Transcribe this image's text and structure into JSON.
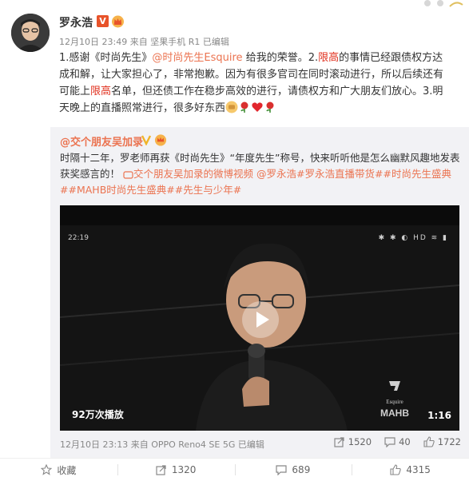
{
  "post": {
    "username": "罗永浩",
    "verified_mark": "V",
    "meta": {
      "time": "12月10日 23:49",
      "source_prefix": "来自",
      "source": "坚果手机 R1",
      "edited": "已编辑"
    },
    "text": {
      "p1": "1.感谢《时尚先生》",
      "link": "@时尚先生Esquire",
      "p2": " 给我的荣誉。2.",
      "red1": "限高",
      "p3": "的事情已经跟债权方达成和解，让大家担心了，非常抱歉。因为有很多官司在同时滚动进行，所以后续还有可能上",
      "red2": "限高",
      "p4": "名单，但还债工作在稳步高效的进行，请债权方和广大朋友们放心。3.明天晚上的直播照常进行，很多好东西"
    }
  },
  "repost": {
    "author": "@交个朋友吴加录",
    "text": {
      "t1": "时隔十二年，罗老师再获《时尚先生》“年度先生”称号，快来听听他是怎么幽默风趣地发表获奖感言的！",
      "video_link": "交个朋友吴加录的微博视频",
      "tag1": "@罗永浩",
      "tag2": "#罗永浩直播带货#",
      "tag3": "#时尚先生盛典#",
      "tag4": "#MAHB时尚先生盛典#",
      "tag5": "#先生与少年#"
    },
    "video": {
      "clock": "22:19",
      "status": "✱ ✱ ◐ HD ≋ ▮",
      "views": "92万次播放",
      "duration": "1:16",
      "logo_text": "Esquire",
      "logo_text2": "MAHB"
    },
    "footer": {
      "time": "12月10日 23:13",
      "source_prefix": "来自",
      "source": "OPPO Reno4 SE 5G",
      "edited": "已编辑"
    },
    "actions": {
      "reposts": "1520",
      "comments": "40",
      "likes": "1722"
    }
  },
  "action_bar": {
    "favorite": "收藏",
    "repost": "1320",
    "comment": "689",
    "like": "4315"
  },
  "colors": {
    "link": "#eb7350",
    "restrict": "#e0301e",
    "repost_bg": "#f2f2f5",
    "verified": "#e8532a"
  },
  "icons": [
    "crown-icon",
    "verified-icon",
    "play-icon",
    "repost-icon",
    "comment-icon",
    "like-icon",
    "star-icon",
    "fist-emoji-icon",
    "rose-icon",
    "heart-icon",
    "video-link-icon"
  ]
}
